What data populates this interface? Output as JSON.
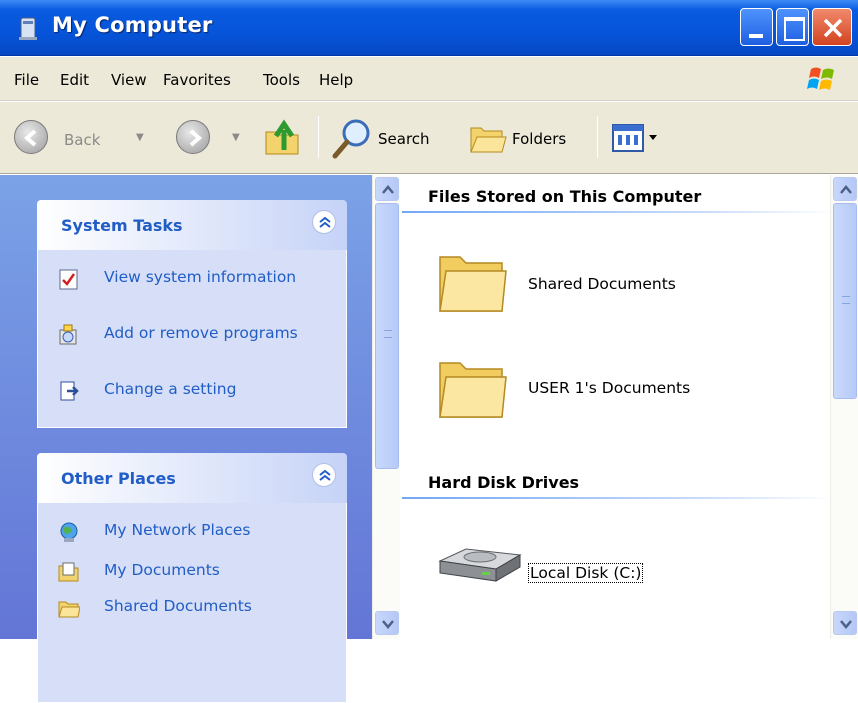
{
  "window": {
    "title": "My Computer",
    "icon": "my-computer-icon"
  },
  "menu": {
    "file": "File",
    "edit": "Edit",
    "view": "View",
    "favorites": "Favorites",
    "tools": "Tools",
    "help": "Help"
  },
  "toolbar": {
    "back_label": "Back",
    "search_label": "Search",
    "folders_label": "Folders"
  },
  "taskpane": {
    "system_tasks": {
      "title": "System Tasks",
      "items": [
        {
          "label": "View system information",
          "icon": "system-info-icon"
        },
        {
          "label": "Add or remove programs",
          "icon": "add-remove-programs-icon"
        },
        {
          "label": "Change a setting",
          "icon": "control-panel-icon"
        }
      ]
    },
    "other_places": {
      "title": "Other Places",
      "items": [
        {
          "label": "My Network Places",
          "icon": "network-places-icon"
        },
        {
          "label": "My Documents",
          "icon": "my-documents-icon"
        },
        {
          "label": "Shared Documents",
          "icon": "folder-icon"
        }
      ]
    }
  },
  "content": {
    "groups": [
      {
        "title": "Files Stored on This Computer",
        "items": [
          {
            "label": "Shared Documents",
            "icon": "folder-icon"
          },
          {
            "label": "USER 1's Documents",
            "icon": "folder-icon"
          }
        ]
      },
      {
        "title": "Hard Disk Drives",
        "items": [
          {
            "label": "Local Disk (C:)",
            "icon": "hard-disk-icon"
          }
        ]
      }
    ]
  },
  "colors": {
    "titlebar": "#0654d9",
    "taskpane_bg": "#7ba2e7",
    "panel_link": "#215dc6",
    "window_bg": "#ece9d8"
  }
}
